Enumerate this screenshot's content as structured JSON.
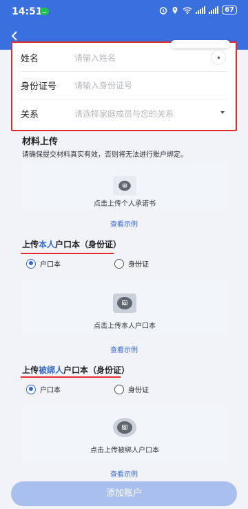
{
  "status_bar": {
    "time": "14:51",
    "battery": "67"
  },
  "form": {
    "rows": [
      {
        "label": "姓名",
        "placeholder": "请输入姓名"
      },
      {
        "label": "身份证号",
        "placeholder": "请输入身份证号"
      },
      {
        "label": "关系",
        "placeholder": "请选择家庭成员与您的关系"
      }
    ]
  },
  "materials": {
    "title": "材料上传",
    "description": "请确保提交材料真实有效，否则将无法进行账户绑定。",
    "commitment_upload": "点击上传个人承诺书",
    "example_link": "查看示例"
  },
  "self_section": {
    "heading_prefix": "上传",
    "heading_highlight": "本人",
    "heading_suffix": "户口本（身份证）",
    "option_hukou": "户口本",
    "option_id": "身份证",
    "upload_label": "点击上传本人户口本",
    "example_link": "查看示例"
  },
  "bound_section": {
    "heading_prefix": "上传",
    "heading_highlight": "被绑人",
    "heading_suffix": "户口本（身份证）",
    "option_hukou": "户口本",
    "option_id": "身份证",
    "upload_label": "点击上传被绑人户口本",
    "example_link": "查看示例"
  },
  "submit_label": "添加账户",
  "colors": {
    "header": "#3a6fe0",
    "accent": "#3569d8",
    "highlight_border": "#e4292a",
    "submit_disabled": "#a9c0ee"
  }
}
